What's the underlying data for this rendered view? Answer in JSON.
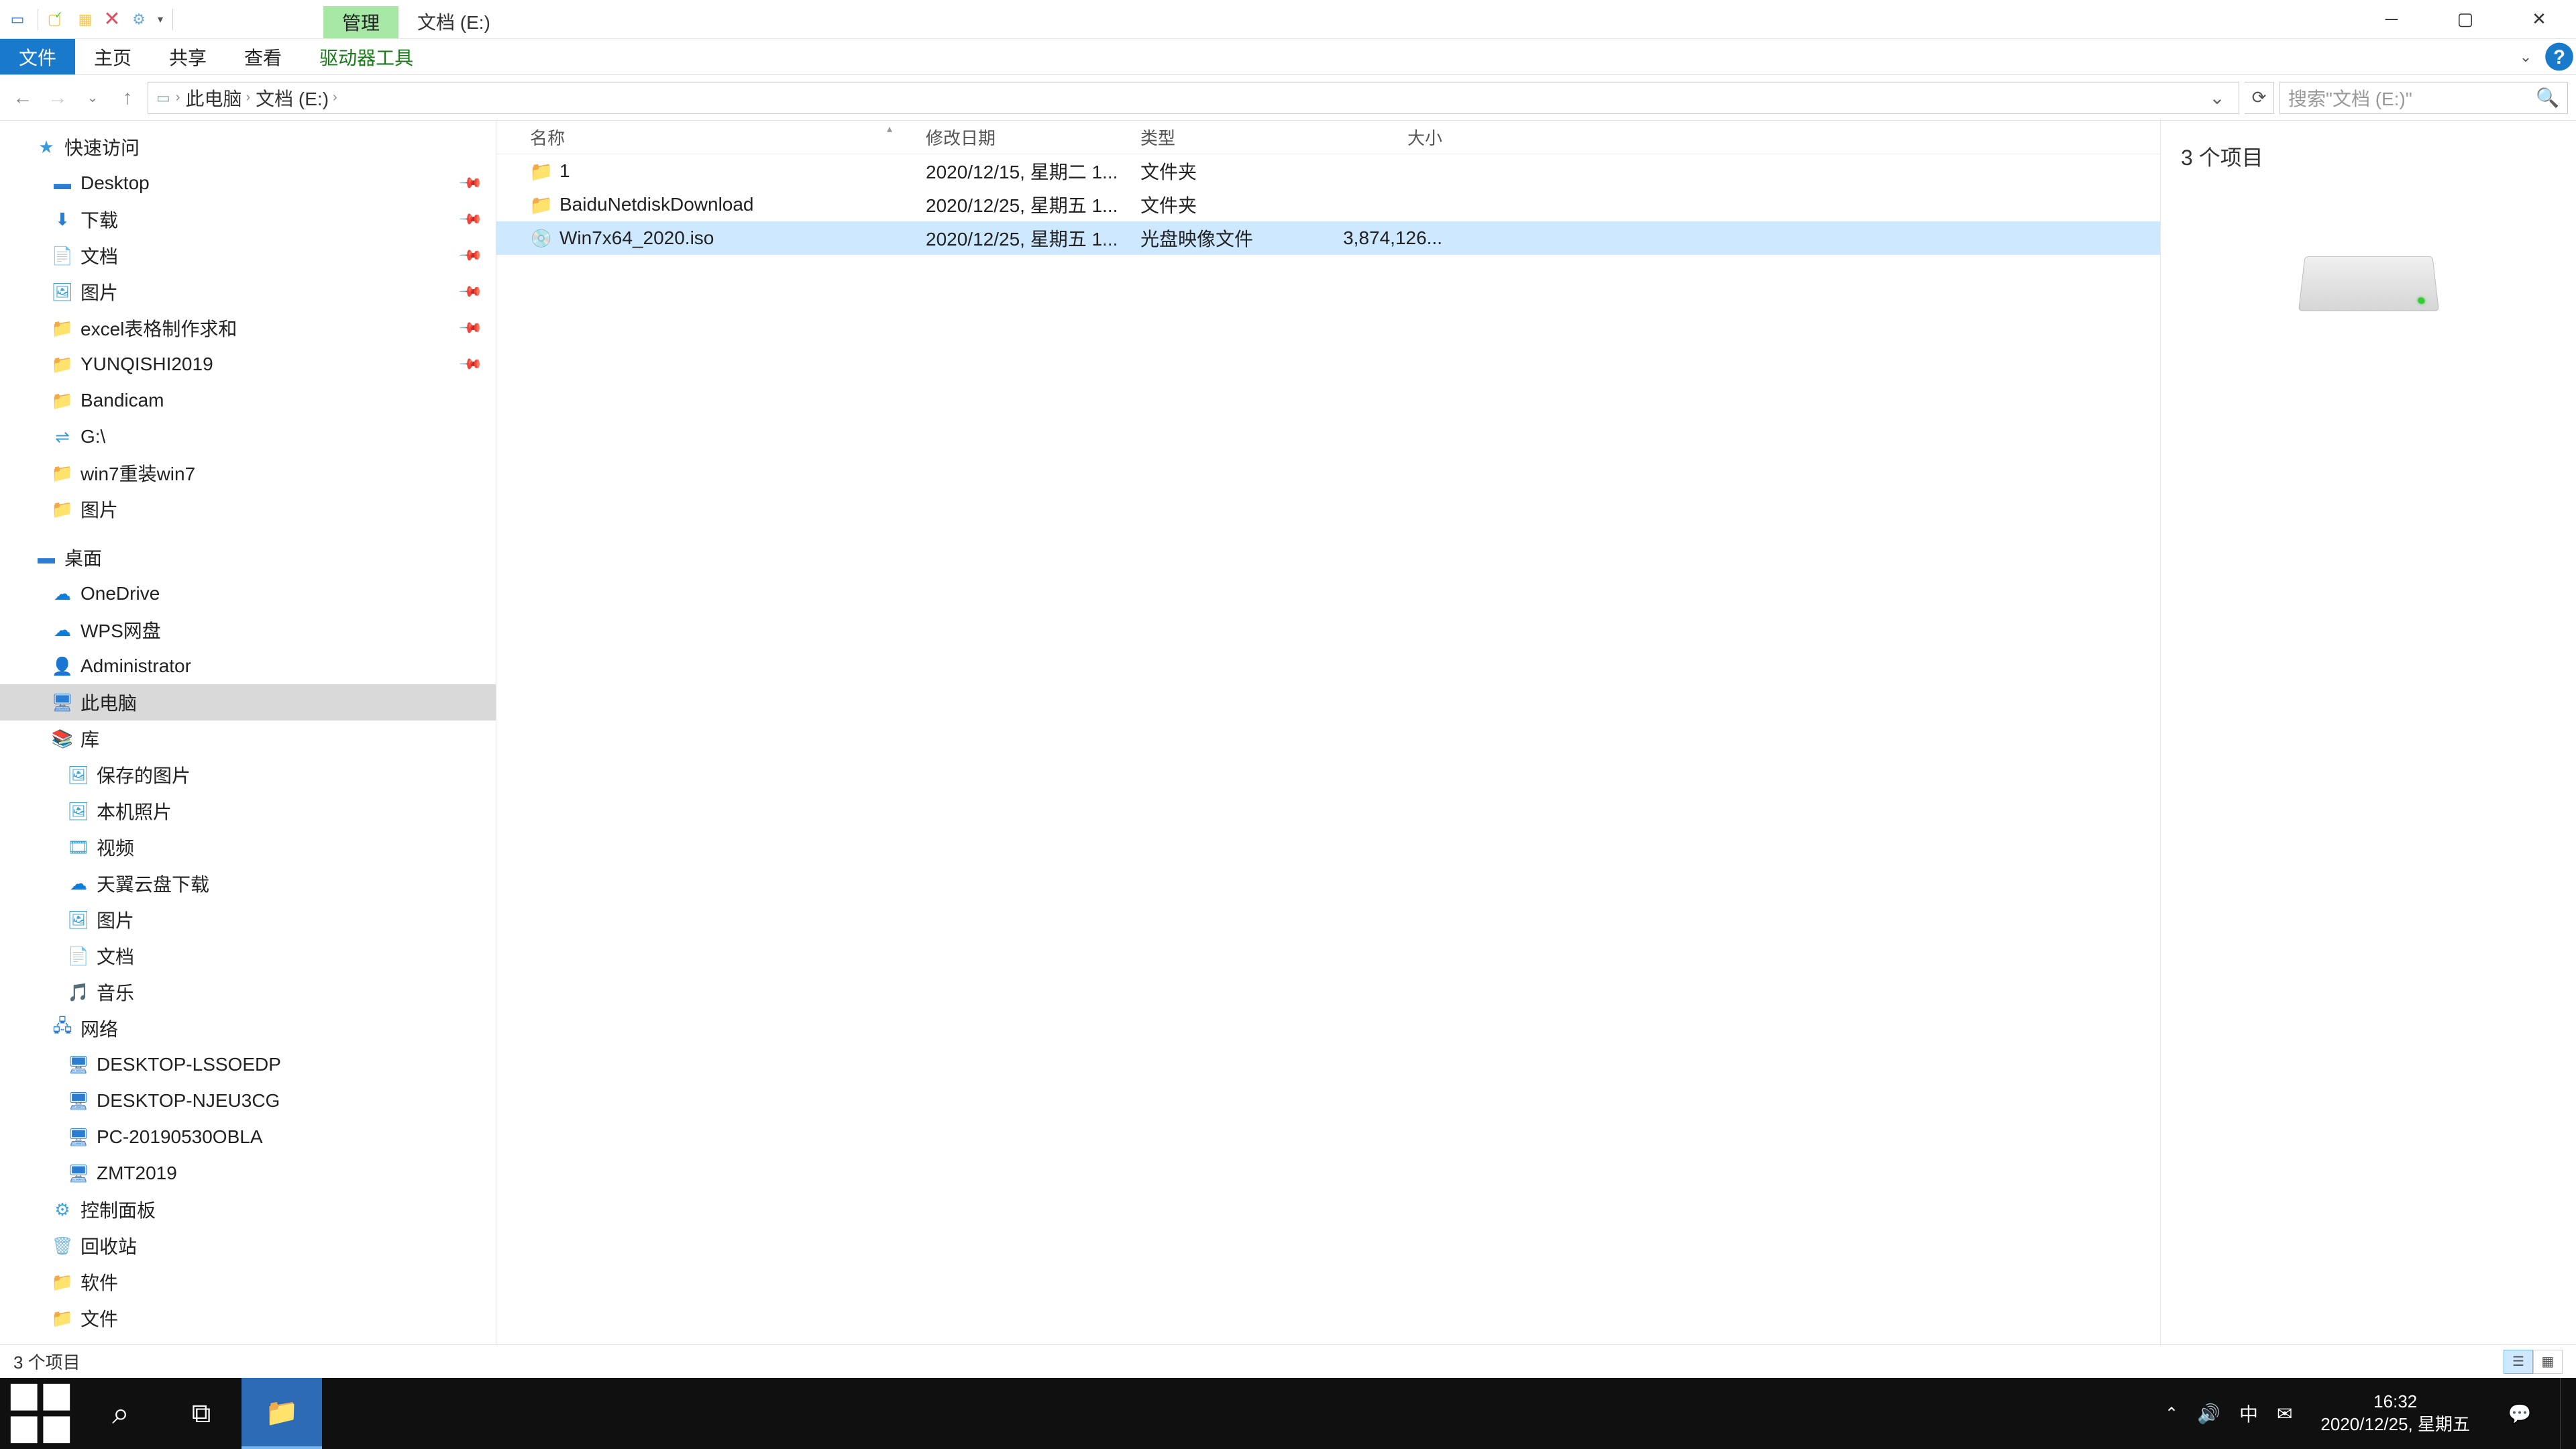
{
  "titlebar": {
    "context_tab": "管理",
    "window_title": "文档 (E:)"
  },
  "ribbon": {
    "file": "文件",
    "home": "主页",
    "share": "共享",
    "view": "查看",
    "drive_tools": "驱动器工具"
  },
  "breadcrumb": {
    "seg0": "此电脑",
    "seg1": "文档 (E:)"
  },
  "search": {
    "placeholder": "搜索\"文档 (E:)\""
  },
  "nav": {
    "quick_access": "快速访问",
    "desktop": "Desktop",
    "downloads": "下载",
    "documents": "文档",
    "pictures": "图片",
    "excel_req": "excel表格制作求和",
    "yunqishi": "YUNQISHI2019",
    "bandicam": "Bandicam",
    "gdrive": "G:\\",
    "win7reinstall": "win7重装win7",
    "pictures2": "图片",
    "desktop_zh": "桌面",
    "onedrive": "OneDrive",
    "wps": "WPS网盘",
    "admin": "Administrator",
    "this_pc": "此电脑",
    "library": "库",
    "saved_pics": "保存的图片",
    "camera_roll": "本机照片",
    "videos": "视频",
    "tyy": "天翼云盘下载",
    "pics_lib": "图片",
    "docs_lib": "文档",
    "music": "音乐",
    "network": "网络",
    "pc1": "DESKTOP-LSSOEDP",
    "pc2": "DESKTOP-NJEU3CG",
    "pc3": "PC-20190530OBLA",
    "pc4": "ZMT2019",
    "ctrl_panel": "控制面板",
    "recycle": "回收站",
    "software": "软件",
    "files": "文件"
  },
  "columns": {
    "name": "名称",
    "date": "修改日期",
    "type": "类型",
    "size": "大小"
  },
  "files": [
    {
      "name": "1",
      "date": "2020/12/15, 星期二 1...",
      "type": "文件夹",
      "size": "",
      "icon": "folder"
    },
    {
      "name": "BaiduNetdiskDownload",
      "date": "2020/12/25, 星期五 1...",
      "type": "文件夹",
      "size": "",
      "icon": "folder"
    },
    {
      "name": "Win7x64_2020.iso",
      "date": "2020/12/25, 星期五 1...",
      "type": "光盘映像文件",
      "size": "3,874,126...",
      "icon": "iso",
      "selected": true
    }
  ],
  "details": {
    "count_label": "3 个项目"
  },
  "status": {
    "text": "3 个项目"
  },
  "tray": {
    "ime": "中",
    "time": "16:32",
    "date": "2020/12/25, 星期五"
  }
}
